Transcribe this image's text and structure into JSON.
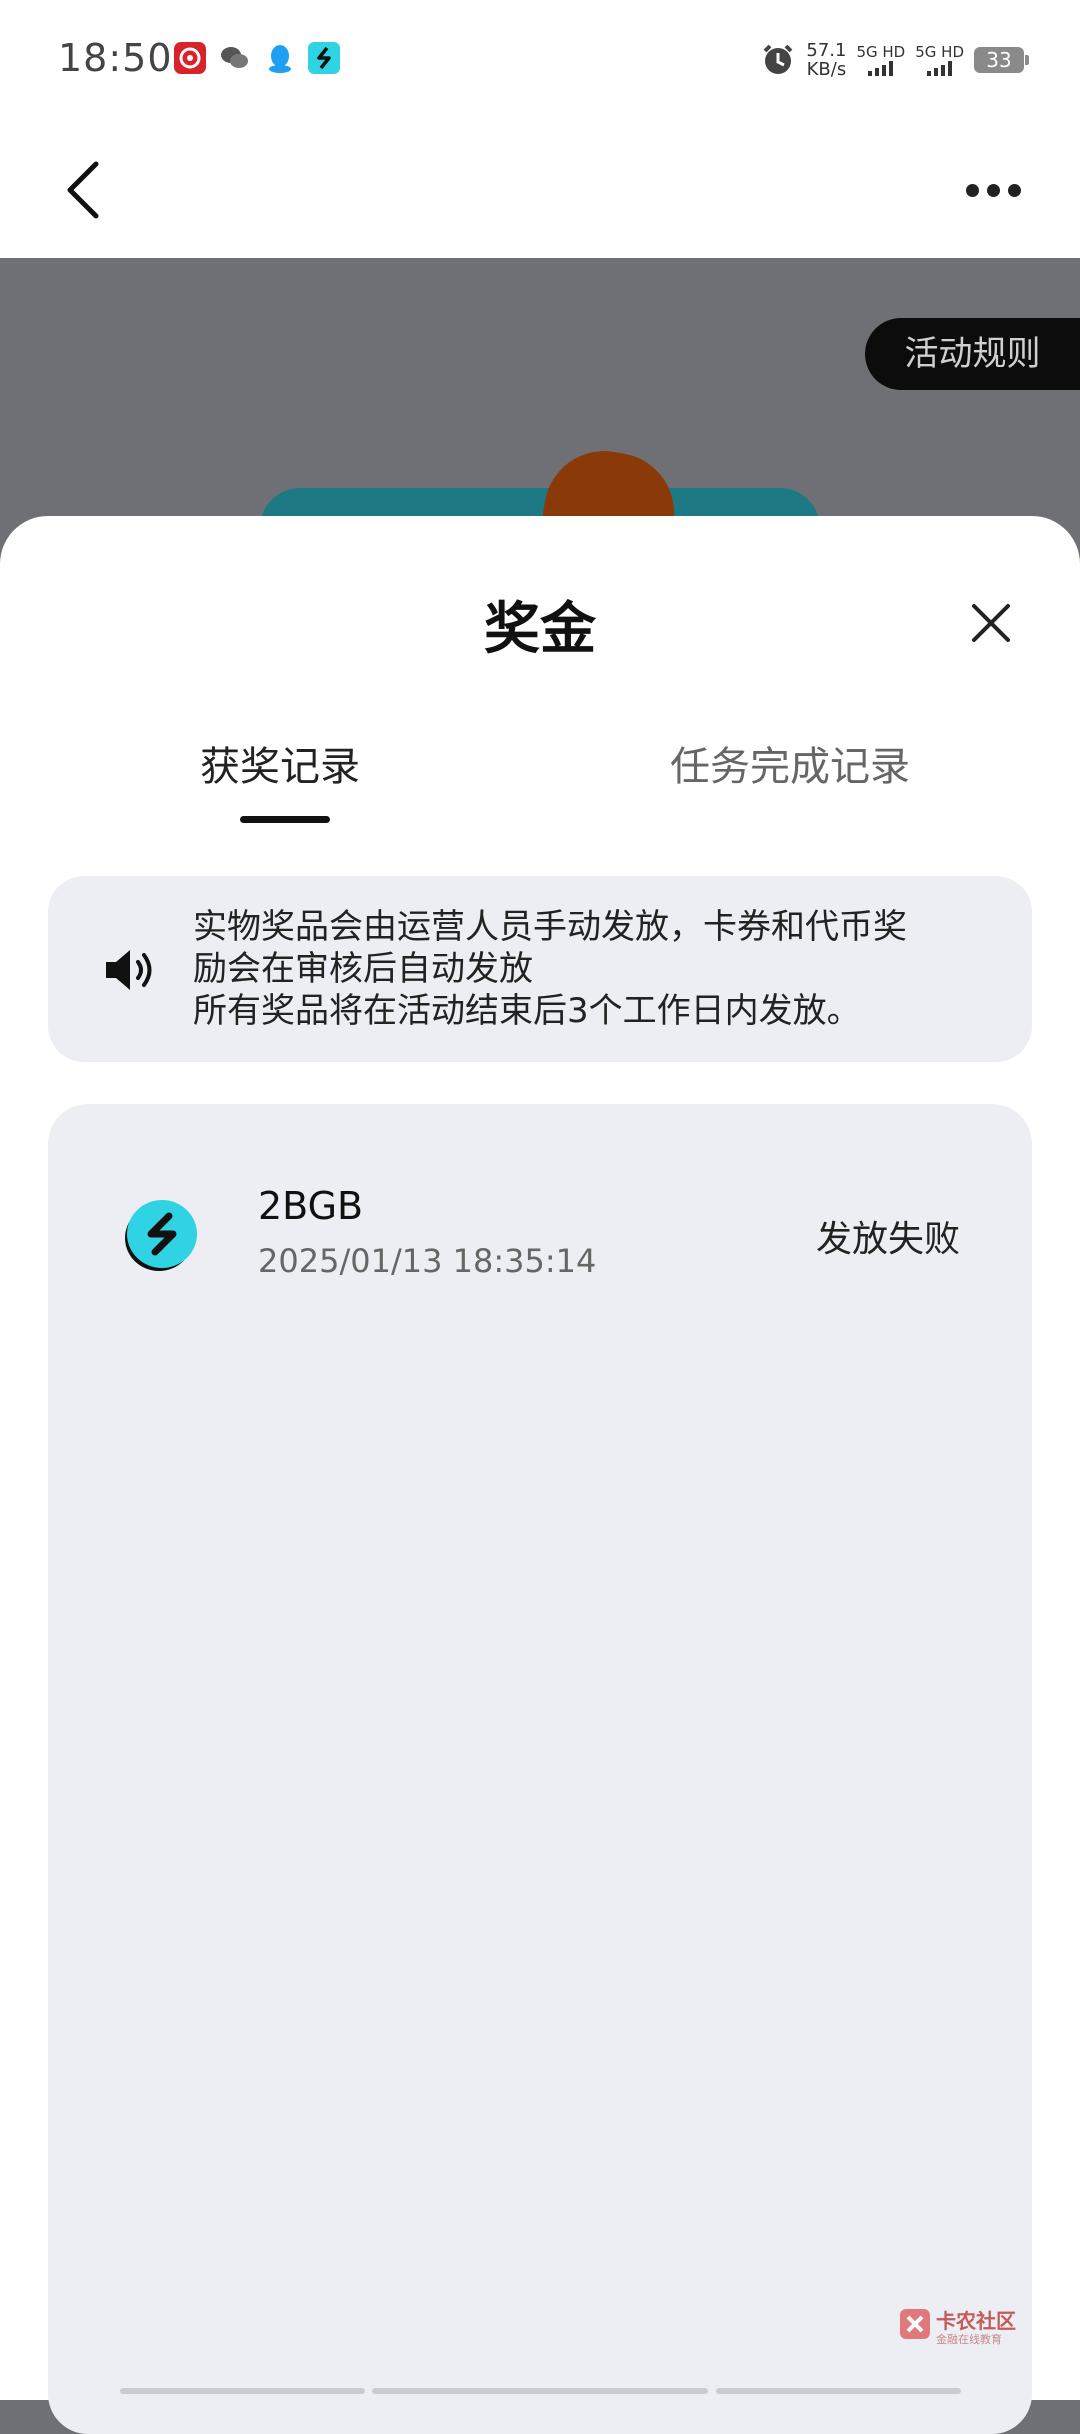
{
  "status_bar": {
    "time": "18:50",
    "net_speed_value": "57.1",
    "net_speed_unit": "KB/s",
    "sim1_label": "5G HD",
    "sim2_label": "5G HD",
    "battery": "33",
    "icons": [
      "netease-music-icon",
      "wechat-icon",
      "qq-icon",
      "app-s-icon",
      "alarm-icon"
    ]
  },
  "nav": {
    "back_icon": "chevron-left-icon",
    "more_icon": "more-dots-icon"
  },
  "banner": {
    "rules_button": "活动规则"
  },
  "sheet": {
    "title": "奖金",
    "tabs": [
      {
        "label": "获奖记录",
        "active": true
      },
      {
        "label": "任务完成记录",
        "active": false
      }
    ],
    "notice": {
      "lines": [
        "实物奖品会由运营人员手动发放，卡券和代币奖",
        "励会在审核后自动发放",
        "所有奖品将在活动结束后3个工作日内发放。"
      ]
    },
    "records": [
      {
        "name": "2BGB",
        "time": "2025/01/13 18:35:14",
        "status": "发放失败",
        "icon": "token-s-icon"
      }
    ]
  },
  "watermark": {
    "title": "卡农社区",
    "subtitle": "金融在线教育"
  },
  "colors": {
    "accent_teal": "#2fd3e3",
    "overlay_gray": "#6f7075",
    "card_bg": "#eceef3"
  }
}
